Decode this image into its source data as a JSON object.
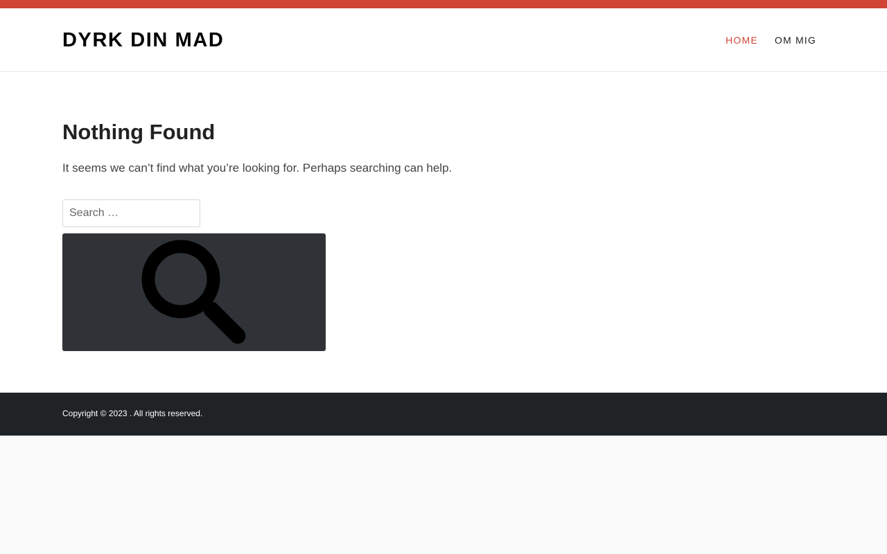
{
  "site": {
    "title": "DYRK DIN MAD"
  },
  "nav": {
    "items": [
      {
        "label": "HOME",
        "active": true
      },
      {
        "label": "OM MIG",
        "active": false
      }
    ]
  },
  "main": {
    "title": "Nothing Found",
    "message": "It seems we can’t find what you’re looking for. Perhaps searching can help.",
    "search": {
      "placeholder": "Search …",
      "value": "",
      "button_icon": "search-icon"
    }
  },
  "footer": {
    "copyright": "Copyright © 2023 . All rights reserved."
  },
  "colors": {
    "accent": "#d04535",
    "button_bg": "#2f3337",
    "footer_bg": "#202326"
  }
}
